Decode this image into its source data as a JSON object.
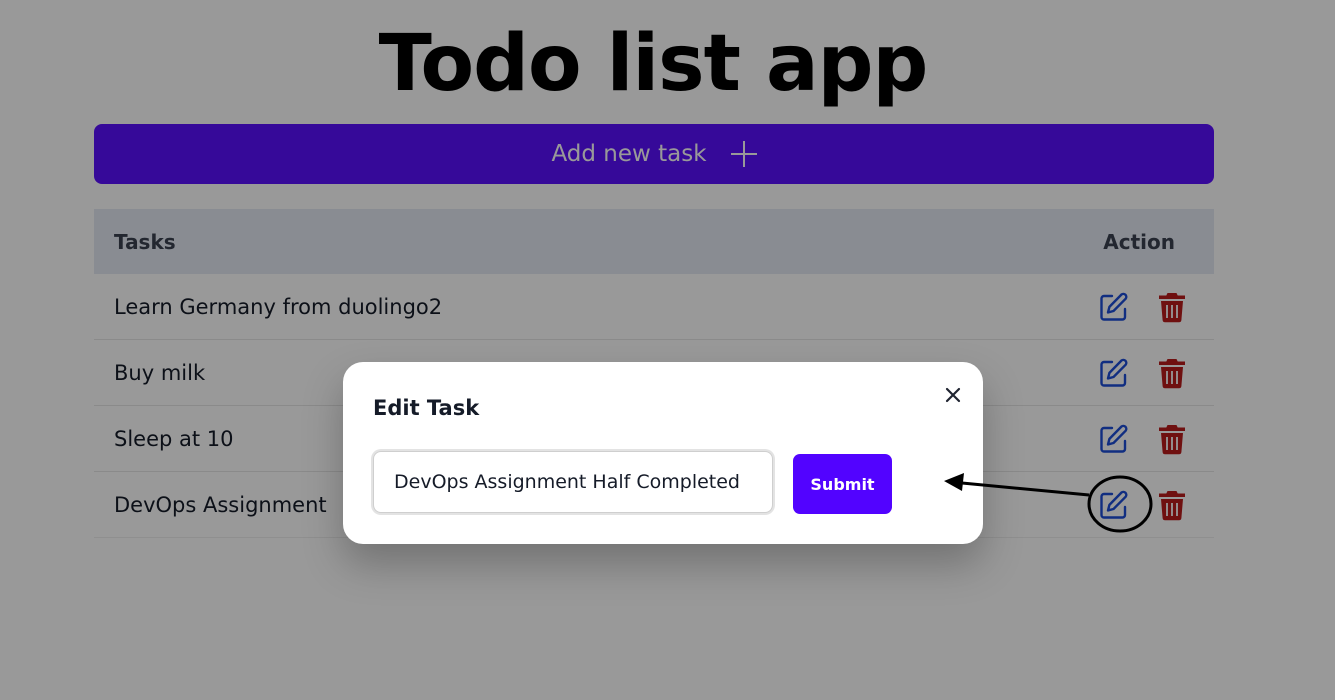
{
  "app": {
    "title": "Todo list app"
  },
  "toolbar": {
    "add_task_label": "Add new task",
    "add_icon": "plus-icon"
  },
  "table": {
    "columns": [
      "Tasks",
      "Action"
    ],
    "rows": [
      {
        "task": "Learn Germany from duolingo2"
      },
      {
        "task": "Buy milk"
      },
      {
        "task": "Sleep at 10"
      },
      {
        "task": "DevOps Assignment"
      }
    ],
    "edit_icon": "edit-icon",
    "delete_icon": "trash-icon"
  },
  "modal": {
    "title": "Edit Task",
    "input_value": "DevOps Assignment Half Completed",
    "submit_label": "Submit",
    "close_icon": "close-icon"
  },
  "colors": {
    "accent": "#5203ff",
    "edit_icon": "#1d4ed8",
    "delete_icon": "#b91c1c",
    "header_bg": "#e4eaf3"
  }
}
